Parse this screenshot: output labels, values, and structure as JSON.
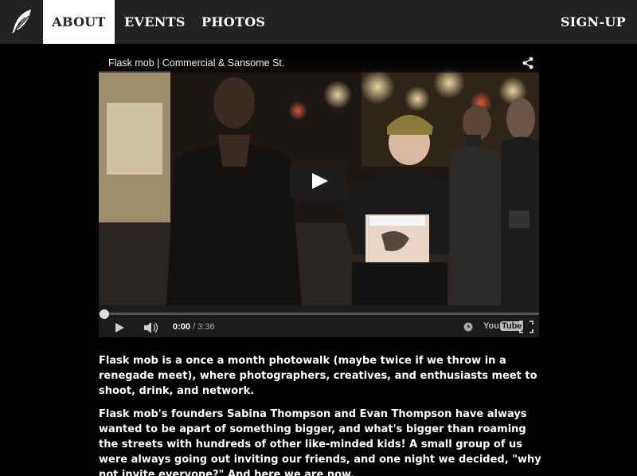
{
  "nav": {
    "logo_icon": "feather-icon",
    "items": [
      {
        "label": "ABOUT",
        "active": true
      },
      {
        "label": "EVENTS",
        "active": false
      },
      {
        "label": "PHOTOS",
        "active": false
      }
    ],
    "signup_label": "SIGN-UP"
  },
  "video": {
    "title": "Flask mob | Commercial & Sansome St.",
    "current_time": "0:00",
    "separator": " / ",
    "duration": "3:36",
    "progress": 0.0,
    "youtube_label": "You",
    "youtube_tube": "Tube"
  },
  "content": {
    "paragraphs": [
      "Flask mob is a once a month photowalk (maybe twice if we throw in a renegade meet), where photographers, creatives, and enthusiasts meet to shoot, drink, and network.",
      "Flask mob's founders Sabina Thompson and Evan Thompson have always wanted to be apart of something bigger, and what's bigger than roaming the streets with hundreds of other like-minded kids! A small group of us were always going out inviting our friends, and one night we decided, \"why not invite everyone?\" And here we are now."
    ]
  },
  "colors": {
    "nav_bg": "#222222",
    "page_bg": "#000000",
    "active_tab_bg": "#ffffff"
  }
}
